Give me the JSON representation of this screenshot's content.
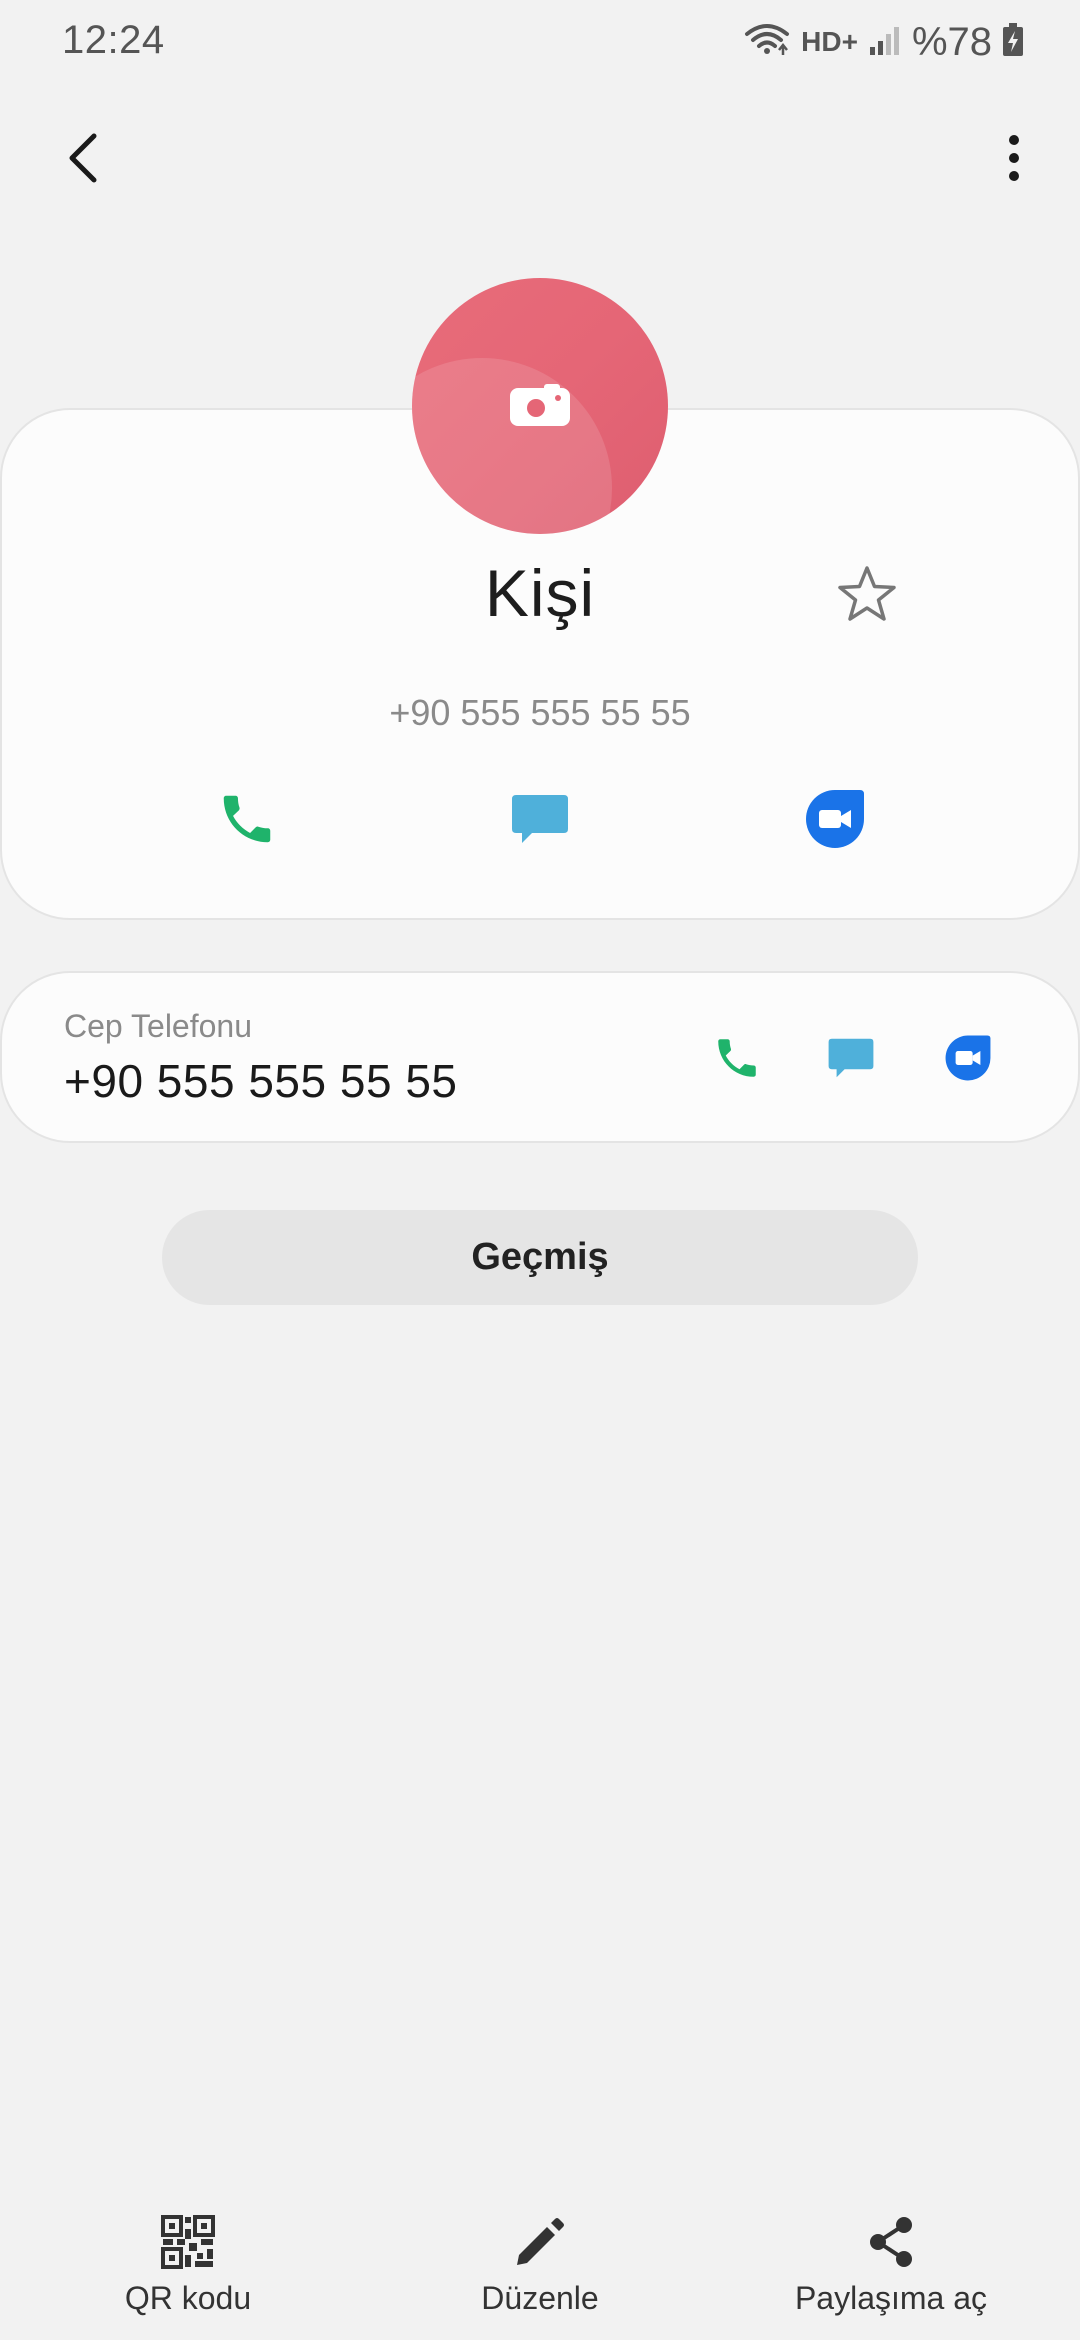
{
  "status_bar": {
    "time": "12:24",
    "network": "HD+",
    "battery": "%78"
  },
  "contact": {
    "name": "Kişi",
    "number": "+90 555 555 55 55",
    "favorite": false,
    "avatar_color": "#e56676"
  },
  "actions": {
    "call_color": "#1fb36b",
    "message_color": "#4fb0da",
    "video_color": "#1a73e8"
  },
  "detail": {
    "label": "Cep Telefonu",
    "number": "+90 555 555 55 55"
  },
  "history_button": "Geçmiş",
  "bottom_bar": {
    "qr": "QR kodu",
    "edit": "Düzenle",
    "share": "Paylaşıma aç"
  }
}
